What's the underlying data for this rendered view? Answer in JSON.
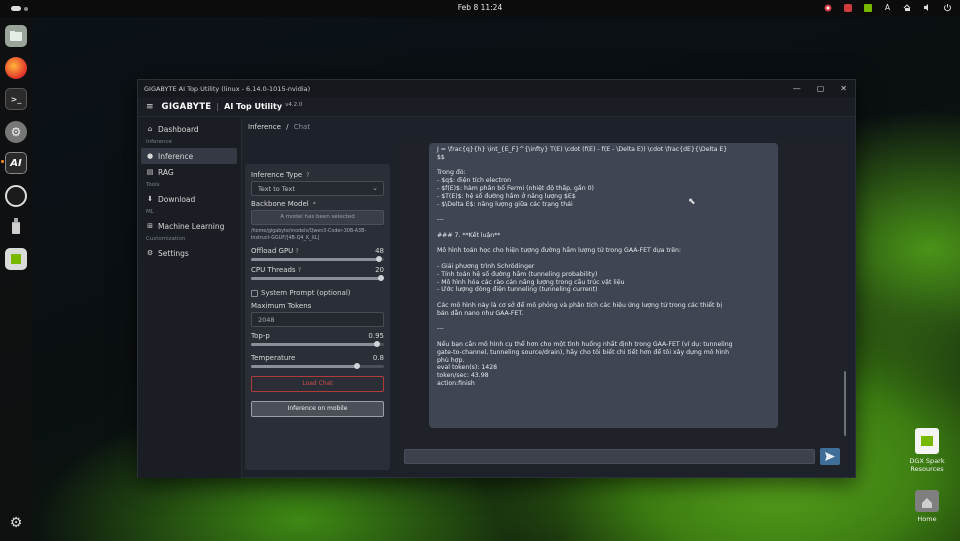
{
  "topbar": {
    "clock": "Feb 8  11:24",
    "tray_letter": "A"
  },
  "dock": {
    "items": [
      "files-icon",
      "firefox-icon",
      "terminal-icon",
      "settings-icon",
      "ai-top-utility-icon",
      "obs-icon",
      "usb-icon",
      "nvidia-app-icon",
      "apps-grid-icon"
    ]
  },
  "desktop": {
    "dgx_label": "DGX Spark Resources",
    "home_label": "Home"
  },
  "window": {
    "title": "GIGABYTE AI Top Utility (linux - 6.14.0-1015-nvidia)",
    "controls": {
      "minimize": "—",
      "maximize": "▢",
      "close": "✕"
    },
    "brand": "GIGABYTE",
    "app_title": "AI Top Utility",
    "version": "v4.2.0"
  },
  "sidebar": {
    "dashboard": "Dashboard",
    "sec_inference": "Inference",
    "inference": "Inference",
    "rag": "RAG",
    "sec_tools": "Tools",
    "download": "Download",
    "sec_ml": "ML",
    "machine_learning": "Machine Learning",
    "sec_customization": "Customization",
    "settings": "Settings"
  },
  "breadcrumb": {
    "root": "Inference",
    "sep": "/",
    "current": "Chat"
  },
  "settings": {
    "inference_type_label": "Inference Type",
    "inference_type_value": "Text to Text",
    "backbone_label": "Backbone Model",
    "backbone_required": "*",
    "backbone_button": "A model has been selected",
    "model_path": "/home/gigabyte/models/Qwen3-Coder-30B-A3B-Instruct-GGUF/[4B-Q4_K_XL]",
    "offload_gpu_label": "Offload GPU",
    "offload_gpu_value": "48",
    "offload_gpu_frac": 0.96,
    "cpu_threads_label": "CPU Threads",
    "cpu_threads_value": "20",
    "cpu_threads_frac": 0.98,
    "system_prompt_label": "System Prompt (optional)",
    "max_tokens_label": "Maximum Tokens",
    "max_tokens_value": "2048",
    "top_p_label": "Top-p",
    "top_p_value": "0.95",
    "top_p_frac": 0.95,
    "temperature_label": "Temperature",
    "temperature_value": "0.8",
    "temperature_frac": 0.8,
    "load_button": "Load Chat",
    "mobile_button": "Inference on mobile"
  },
  "chat": {
    "lines": [
      "J = \\frac{q}{h} \\int_{E_F}^{\\infty} T(E) \\cdot (f(E) - f(E - \\Delta E)) \\cdot \\frac{dE}{\\Delta E}",
      "$$",
      "",
      "Trong đó:",
      "- $q$: điện tích electron",
      "- $f(E)$: hàm phân bố Fermi (nhiệt độ thấp, gần 0)",
      "- $T(E)$: hệ số đường hầm ở năng lượng $E$",
      "- $\\Delta E$: năng lượng giữa các trạng thái",
      "",
      "---",
      "",
      "### 7. **Kết luận**",
      "",
      "Mô hình toán học cho hiện tượng đường hầm lượng tử trong GAA-FET dựa trên:",
      "",
      "- Giải phương trình Schrödinger",
      "- Tính toán hệ số đường hầm (tunneling probability)",
      "- Mô hình hóa các rào cản năng lượng trong cấu trúc vật liệu",
      "- Ước lượng dòng điện tunneling (tunneling current)",
      "",
      "Các mô hình này là cơ sở để mô phỏng và phân tích các hiệu ứng lượng tử trong các thiết bị",
      "bán dẫn nano như GAA-FET.",
      "",
      "---",
      "",
      "Nếu bạn cần mô hình cụ thể hơn cho một tình huống nhất định trong GAA-FET (ví dụ: tunneling",
      "gate-to-channel, tunneling source/drain), hãy cho tôi biết chi tiết hơn để tôi xây dựng mô hình",
      "phù hợp.",
      "eval token(s): 1428",
      "token/sec: 43.98",
      "action:finish"
    ],
    "input_placeholder": ""
  }
}
